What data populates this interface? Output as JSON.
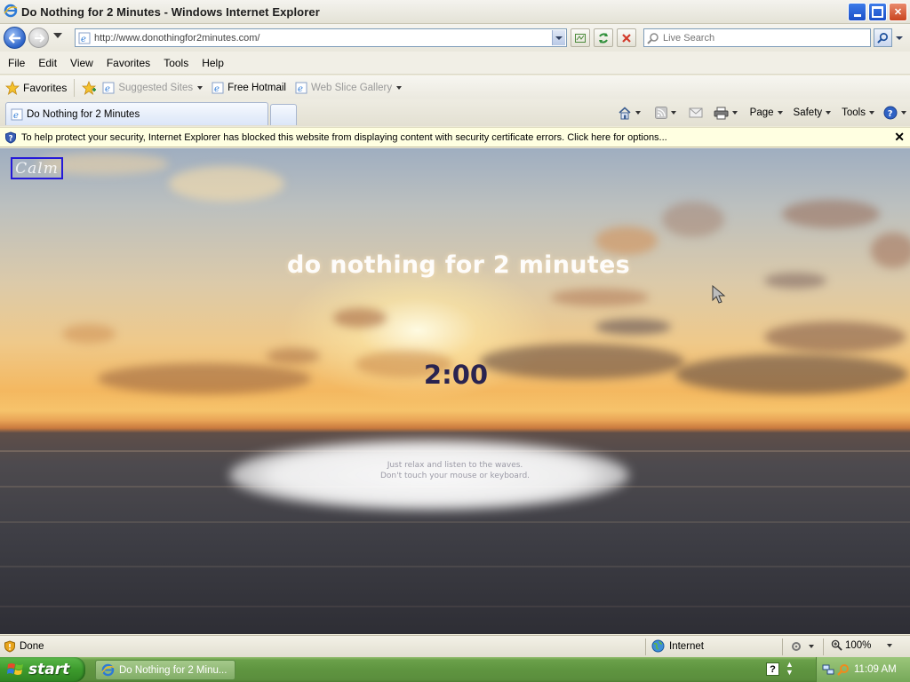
{
  "window": {
    "title": "Do Nothing for 2 Minutes - Windows Internet Explorer"
  },
  "address_bar": {
    "url": "http://www.donothingfor2minutes.com/",
    "search_placeholder": "Live Search"
  },
  "menu": [
    "File",
    "Edit",
    "View",
    "Favorites",
    "Tools",
    "Help"
  ],
  "favorites_bar": {
    "favorites_label": "Favorites",
    "items": [
      {
        "label": "Suggested Sites",
        "enabled": false,
        "has_dropdown": true
      },
      {
        "label": "Free Hotmail",
        "enabled": true,
        "has_dropdown": false
      },
      {
        "label": "Web Slice Gallery",
        "enabled": false,
        "has_dropdown": true
      }
    ]
  },
  "tabs": {
    "active_tab": "Do Nothing for 2 Minutes"
  },
  "command_bar": {
    "page": "Page",
    "safety": "Safety",
    "tools": "Tools"
  },
  "info_bar": {
    "message": "To help protect your security, Internet Explorer has blocked this website from displaying content with security certificate errors. Click here for options..."
  },
  "page": {
    "logo_text": "Calm",
    "headline": "do nothing for 2 minutes",
    "timer": "2:00",
    "instruction_line1": "Just relax and listen to the waves.",
    "instruction_line2": "Don't touch your mouse or keyboard."
  },
  "status_bar": {
    "status": "Done",
    "zone": "Internet",
    "zoom": "100%"
  },
  "taskbar": {
    "start_label": "start",
    "task_button": "Do Nothing for 2 Minu...",
    "clock": "11:09 AM"
  },
  "colors": {
    "accent_blue": "#2c63c8",
    "timer_color": "#2a2450",
    "logo_border": "#2419d8",
    "taskbar_green": "#5f9540",
    "info_bar_bg": "#ffffe1"
  }
}
